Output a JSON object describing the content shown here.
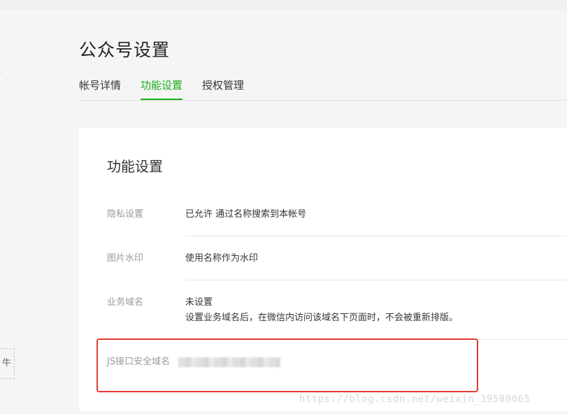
{
  "page": {
    "title": "公众号设置"
  },
  "tabs": [
    {
      "label": "帐号详情",
      "active": false
    },
    {
      "label": "功能设置",
      "active": true
    },
    {
      "label": "授权管理",
      "active": false
    }
  ],
  "side_hint": {
    "text": "牛"
  },
  "card": {
    "title": "功能设置",
    "rows": [
      {
        "label": "隐私设置",
        "value": "已允许 通过名称搜索到本帐号"
      },
      {
        "label": "图片水印",
        "value": "使用名称作为水印"
      },
      {
        "label": "业务域名",
        "value": "未设置",
        "desc": "设置业务域名后，在微信内访问该域名下页面时，不会被重新排版。"
      },
      {
        "label": "JS接口安全域名",
        "value": ""
      }
    ]
  },
  "watermark": {
    "text": "https://blog.csdn.net/weixin_39589065"
  },
  "colors": {
    "accent": "#1aad19",
    "highlight": "#e53935",
    "background": "#f5f5f5",
    "card": "#ffffff"
  }
}
